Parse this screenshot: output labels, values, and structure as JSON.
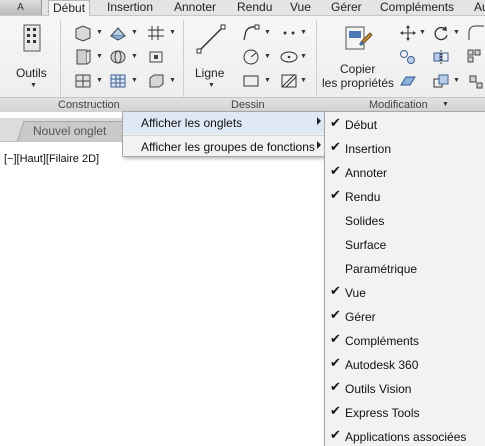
{
  "app_button": {
    "label": "A"
  },
  "tabs": [
    "Début",
    "Insertion",
    "Annoter",
    "Rendu",
    "Vue",
    "Gérer",
    "Compléments",
    "Au"
  ],
  "active_tab": "Début",
  "ribbon": {
    "tools": {
      "outils": "Outils",
      "ligne": "Ligne",
      "copier_line1": "Copier",
      "copier_line2": "les propriétés"
    },
    "panels": {
      "construction": "Construction",
      "dessin": "Dessin",
      "modification": "Modification"
    }
  },
  "file_tab": {
    "label": "Nouvel onglet"
  },
  "viewport_label": "[−][Haut][Filaire 2D]",
  "context_menu": {
    "items": [
      {
        "label": "Afficher les onglets",
        "highlighted": true
      },
      {
        "label": "Afficher les groupes de fonctions",
        "highlighted": false
      }
    ]
  },
  "submenu": {
    "check_glyph": "✔",
    "items": [
      {
        "label": "Début",
        "checked": true
      },
      {
        "label": "Insertion",
        "checked": true
      },
      {
        "label": "Annoter",
        "checked": true
      },
      {
        "label": "Rendu",
        "checked": true
      },
      {
        "label": "Solides",
        "checked": false
      },
      {
        "label": "Surface",
        "checked": false
      },
      {
        "label": "Paramétrique",
        "checked": false
      },
      {
        "label": "Vue",
        "checked": true
      },
      {
        "label": "Gérer",
        "checked": true
      },
      {
        "label": "Compléments",
        "checked": true
      },
      {
        "label": "Autodesk 360",
        "checked": true
      },
      {
        "label": "Outils Vision",
        "checked": true
      },
      {
        "label": "Express Tools",
        "checked": true
      },
      {
        "label": "Applications associées",
        "checked": true
      }
    ]
  },
  "colors": {
    "accent": "#4a78b5",
    "menu_highlight": "#dfe8f5",
    "menu_bg": "#f2f2f2"
  }
}
